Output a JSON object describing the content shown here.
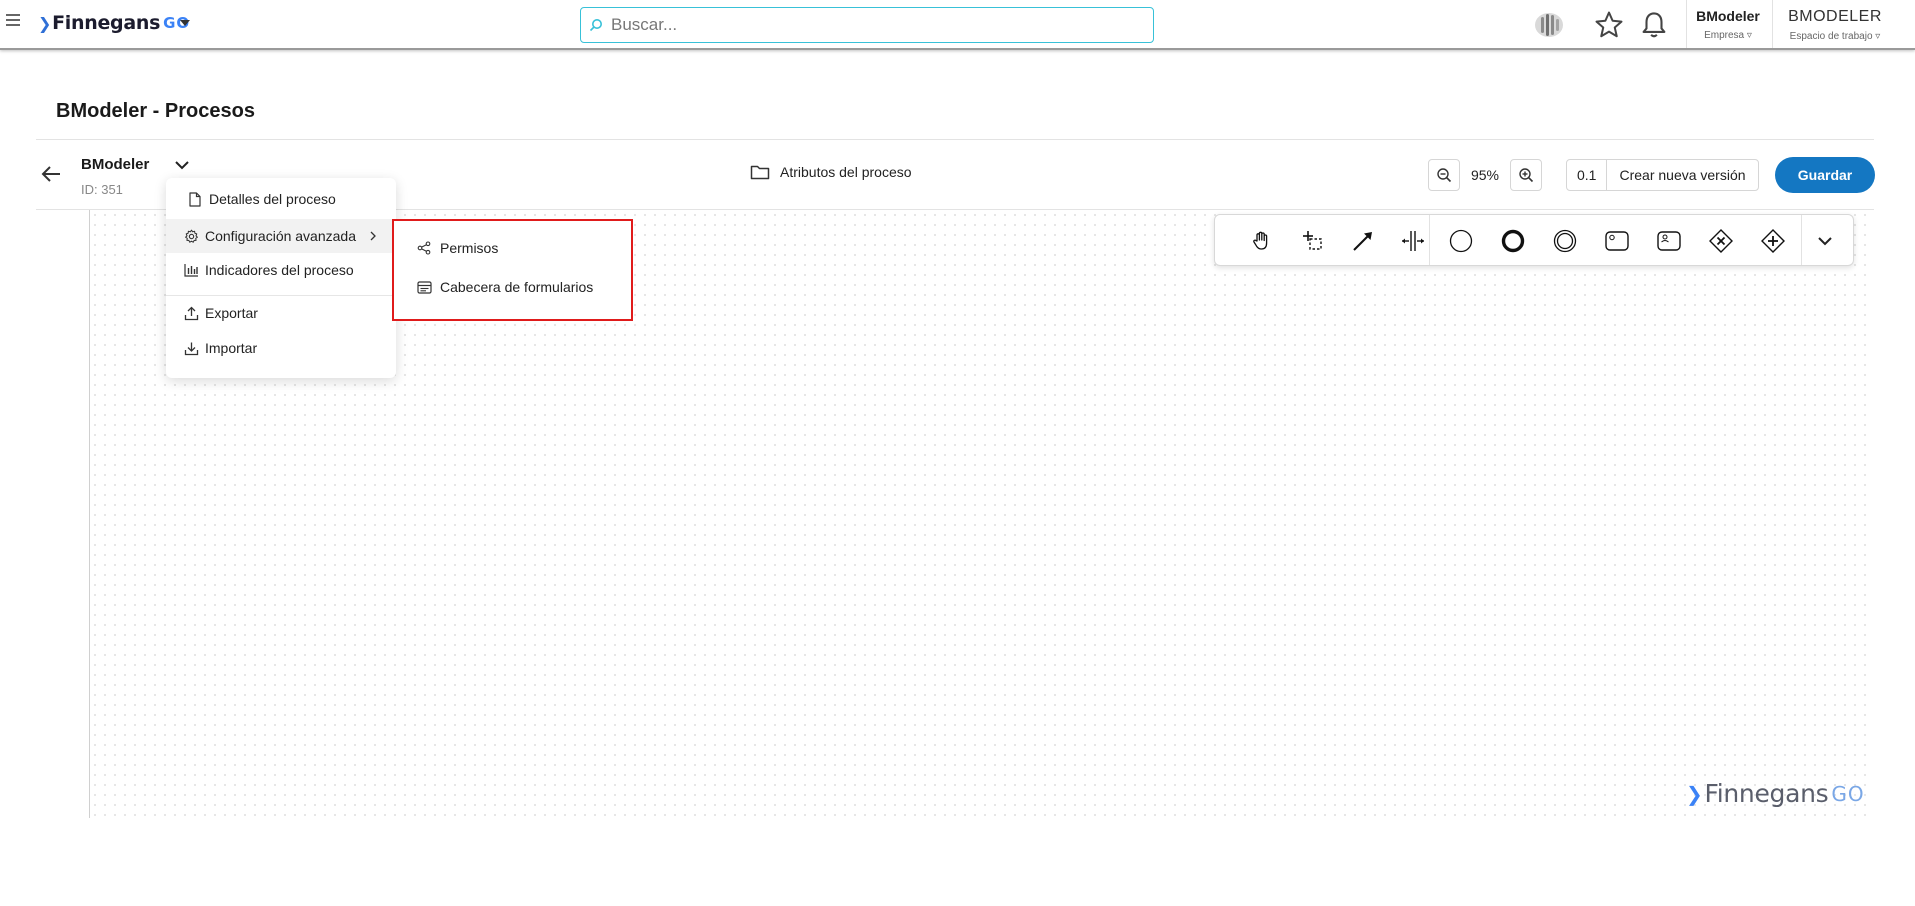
{
  "header": {
    "logo_text": "Finnegans",
    "logo_suffix": "GO",
    "search_placeholder": "Buscar...",
    "company": {
      "name": "BModeler",
      "label": "Empresa"
    },
    "workspace": {
      "name": "BMODELER",
      "label": "Espacio de trabajo"
    }
  },
  "page": {
    "title": "BModeler - Procesos"
  },
  "process": {
    "name": "BModeler",
    "id": "ID: 351",
    "attributes_label": "Atributos del proceso",
    "zoom": "95%",
    "version": "0.1",
    "new_version_label": "Crear nueva versión",
    "save_label": "Guardar"
  },
  "menu": {
    "items": [
      {
        "label": "Detalles del proceso",
        "icon": "file-icon"
      },
      {
        "label": "Configuración avanzada",
        "icon": "gear-icon"
      },
      {
        "label": "Indicadores del proceso",
        "icon": "bar-chart-icon"
      },
      {
        "label": "Exportar",
        "icon": "export-icon"
      },
      {
        "label": "Importar",
        "icon": "import-icon"
      }
    ]
  },
  "submenu": {
    "items": [
      {
        "label": "Permisos",
        "icon": "share-icon"
      },
      {
        "label": "Cabecera de formularios",
        "icon": "form-header-icon"
      }
    ]
  },
  "palette": {
    "tools": [
      "hand-tool-icon",
      "lasso-tool-icon",
      "connect-arrow-icon",
      "space-tool-icon",
      "start-event-icon",
      "end-event-icon",
      "intermediate-event-icon",
      "task-icon",
      "user-task-icon",
      "exclusive-gateway-icon",
      "parallel-gateway-icon",
      "more-chevron-icon"
    ]
  },
  "watermark": {
    "text": "Finnegans",
    "suffix": "GO"
  },
  "colors": {
    "accent": "#1477c2",
    "highlight_border": "#e01b1b",
    "search_border": "#38c1d8"
  }
}
